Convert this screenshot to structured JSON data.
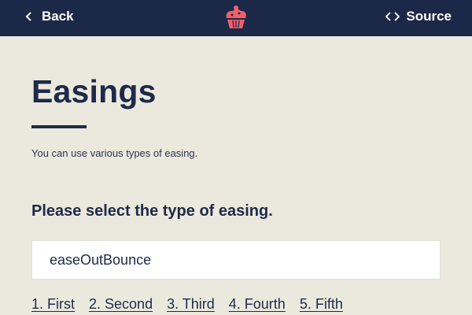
{
  "nav": {
    "back_label": "Back",
    "back_icon": "chevron-left-icon",
    "source_label": "Source",
    "source_icon": "code-brackets-icon",
    "logo_icon": "cupcake-icon"
  },
  "main": {
    "title": "Easings",
    "description": "You can use various types of easing."
  },
  "selector": {
    "heading": "Please select the type of easing.",
    "selected_value": "easeOutBounce"
  },
  "links": [
    {
      "label": "1. First"
    },
    {
      "label": "2. Second"
    },
    {
      "label": "3. Third"
    },
    {
      "label": "4. Fourth"
    },
    {
      "label": "5. Fifth"
    }
  ],
  "colors": {
    "header_bg": "#1c2848",
    "page_bg": "#ebe9dd",
    "text": "#1e2a4a",
    "logo": "#f0606a"
  }
}
